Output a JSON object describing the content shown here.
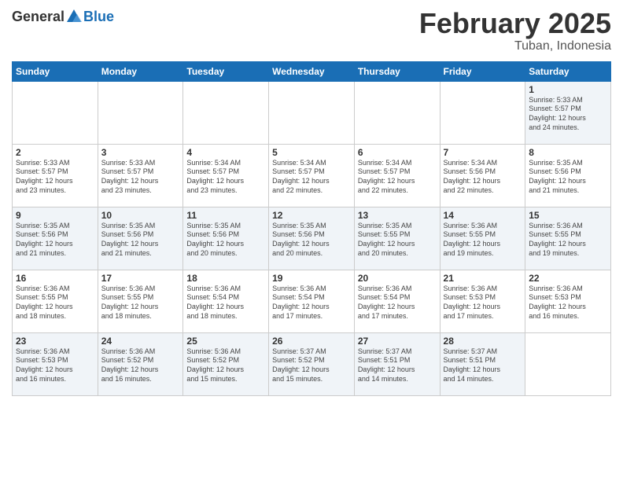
{
  "header": {
    "logo": {
      "text_general": "General",
      "text_blue": "Blue"
    },
    "title": "February 2025",
    "location": "Tuban, Indonesia"
  },
  "days_of_week": [
    "Sunday",
    "Monday",
    "Tuesday",
    "Wednesday",
    "Thursday",
    "Friday",
    "Saturday"
  ],
  "weeks": [
    [
      {
        "day": "",
        "info": ""
      },
      {
        "day": "",
        "info": ""
      },
      {
        "day": "",
        "info": ""
      },
      {
        "day": "",
        "info": ""
      },
      {
        "day": "",
        "info": ""
      },
      {
        "day": "",
        "info": ""
      },
      {
        "day": "1",
        "info": "Sunrise: 5:33 AM\nSunset: 5:57 PM\nDaylight: 12 hours\nand 24 minutes."
      }
    ],
    [
      {
        "day": "2",
        "info": "Sunrise: 5:33 AM\nSunset: 5:57 PM\nDaylight: 12 hours\nand 23 minutes."
      },
      {
        "day": "3",
        "info": "Sunrise: 5:33 AM\nSunset: 5:57 PM\nDaylight: 12 hours\nand 23 minutes."
      },
      {
        "day": "4",
        "info": "Sunrise: 5:34 AM\nSunset: 5:57 PM\nDaylight: 12 hours\nand 23 minutes."
      },
      {
        "day": "5",
        "info": "Sunrise: 5:34 AM\nSunset: 5:57 PM\nDaylight: 12 hours\nand 22 minutes."
      },
      {
        "day": "6",
        "info": "Sunrise: 5:34 AM\nSunset: 5:57 PM\nDaylight: 12 hours\nand 22 minutes."
      },
      {
        "day": "7",
        "info": "Sunrise: 5:34 AM\nSunset: 5:56 PM\nDaylight: 12 hours\nand 22 minutes."
      },
      {
        "day": "8",
        "info": "Sunrise: 5:35 AM\nSunset: 5:56 PM\nDaylight: 12 hours\nand 21 minutes."
      }
    ],
    [
      {
        "day": "9",
        "info": "Sunrise: 5:35 AM\nSunset: 5:56 PM\nDaylight: 12 hours\nand 21 minutes."
      },
      {
        "day": "10",
        "info": "Sunrise: 5:35 AM\nSunset: 5:56 PM\nDaylight: 12 hours\nand 21 minutes."
      },
      {
        "day": "11",
        "info": "Sunrise: 5:35 AM\nSunset: 5:56 PM\nDaylight: 12 hours\nand 20 minutes."
      },
      {
        "day": "12",
        "info": "Sunrise: 5:35 AM\nSunset: 5:56 PM\nDaylight: 12 hours\nand 20 minutes."
      },
      {
        "day": "13",
        "info": "Sunrise: 5:35 AM\nSunset: 5:55 PM\nDaylight: 12 hours\nand 20 minutes."
      },
      {
        "day": "14",
        "info": "Sunrise: 5:36 AM\nSunset: 5:55 PM\nDaylight: 12 hours\nand 19 minutes."
      },
      {
        "day": "15",
        "info": "Sunrise: 5:36 AM\nSunset: 5:55 PM\nDaylight: 12 hours\nand 19 minutes."
      }
    ],
    [
      {
        "day": "16",
        "info": "Sunrise: 5:36 AM\nSunset: 5:55 PM\nDaylight: 12 hours\nand 18 minutes."
      },
      {
        "day": "17",
        "info": "Sunrise: 5:36 AM\nSunset: 5:55 PM\nDaylight: 12 hours\nand 18 minutes."
      },
      {
        "day": "18",
        "info": "Sunrise: 5:36 AM\nSunset: 5:54 PM\nDaylight: 12 hours\nand 18 minutes."
      },
      {
        "day": "19",
        "info": "Sunrise: 5:36 AM\nSunset: 5:54 PM\nDaylight: 12 hours\nand 17 minutes."
      },
      {
        "day": "20",
        "info": "Sunrise: 5:36 AM\nSunset: 5:54 PM\nDaylight: 12 hours\nand 17 minutes."
      },
      {
        "day": "21",
        "info": "Sunrise: 5:36 AM\nSunset: 5:53 PM\nDaylight: 12 hours\nand 17 minutes."
      },
      {
        "day": "22",
        "info": "Sunrise: 5:36 AM\nSunset: 5:53 PM\nDaylight: 12 hours\nand 16 minutes."
      }
    ],
    [
      {
        "day": "23",
        "info": "Sunrise: 5:36 AM\nSunset: 5:53 PM\nDaylight: 12 hours\nand 16 minutes."
      },
      {
        "day": "24",
        "info": "Sunrise: 5:36 AM\nSunset: 5:52 PM\nDaylight: 12 hours\nand 16 minutes."
      },
      {
        "day": "25",
        "info": "Sunrise: 5:36 AM\nSunset: 5:52 PM\nDaylight: 12 hours\nand 15 minutes."
      },
      {
        "day": "26",
        "info": "Sunrise: 5:37 AM\nSunset: 5:52 PM\nDaylight: 12 hours\nand 15 minutes."
      },
      {
        "day": "27",
        "info": "Sunrise: 5:37 AM\nSunset: 5:51 PM\nDaylight: 12 hours\nand 14 minutes."
      },
      {
        "day": "28",
        "info": "Sunrise: 5:37 AM\nSunset: 5:51 PM\nDaylight: 12 hours\nand 14 minutes."
      },
      {
        "day": "",
        "info": ""
      }
    ]
  ]
}
